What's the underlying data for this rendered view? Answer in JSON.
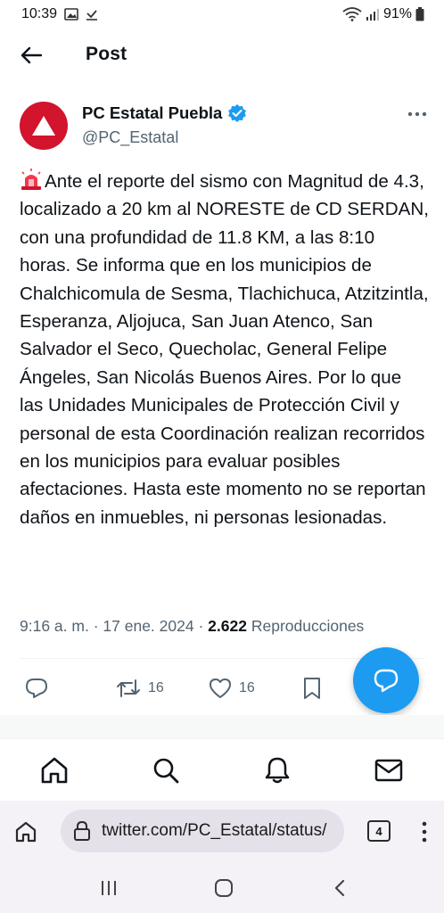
{
  "status_bar": {
    "time": "10:39",
    "battery": "91%"
  },
  "header": {
    "title": "Post",
    "back_icon": "arrow-left-icon"
  },
  "author": {
    "name": "PC Estatal Puebla",
    "handle": "@PC_Estatal",
    "verified": true,
    "avatar_color": "#d2142c"
  },
  "tweet": {
    "emoji": "police-siren-emoji",
    "text": "Ante el reporte del sismo con Magnitud de 4.3, localizado a 20 km al NORESTE de CD SERDAN, con una profundidad de 11.8 KM, a las 8:10 horas. Se informa que en los municipios de Chalchicomula de Sesma, Tlachichuca, Atzitzintla, Esperanza, Aljojuca, San Juan Atenco, San Salvador el Seco, Quecholac, General Felipe Ángeles, San Nicolás Buenos Aires. Por lo que las Unidades Municipales de Protección Civil y personal de esta Coordinación realizan recorridos en los municipios para evaluar posibles afectaciones. Hasta este momento no se reportan daños en inmuebles, ni personas lesionadas."
  },
  "meta": {
    "time": "9:16 a. m.",
    "separator": "·",
    "date": "17 ene. 2024",
    "views_count": "2.622",
    "views_label": "Reproducciones"
  },
  "actions": {
    "reposts": "16",
    "likes": "16"
  },
  "browser": {
    "url": "twitter.com/PC_Estatal/status/",
    "tab_count": "4"
  },
  "colors": {
    "accent": "#1d9bf0",
    "secondary_text": "#536471",
    "primary_text": "#0f1419"
  }
}
